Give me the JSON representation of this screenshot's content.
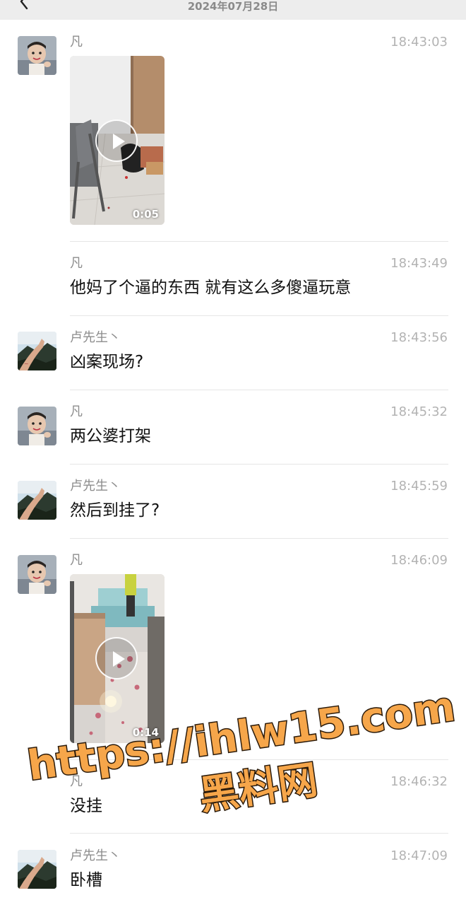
{
  "header": {
    "date": "2024年07月28日",
    "back_icon": "chevron-left-icon"
  },
  "messages": [
    {
      "sender": "凡",
      "time": "18:43:03",
      "type": "video",
      "duration": "0:05",
      "avatar": "avatar-child"
    },
    {
      "sender": "凡",
      "time": "18:43:49",
      "type": "text",
      "text": "他妈了个逼的东西 就有这么多傻逼玩意"
    },
    {
      "sender": "卢先生丶",
      "time": "18:43:56",
      "type": "text",
      "text": "凶案现场?",
      "avatar": "avatar-landscape"
    },
    {
      "sender": "凡",
      "time": "18:45:32",
      "type": "text",
      "text": "两公婆打架",
      "avatar": "avatar-child"
    },
    {
      "sender": "卢先生丶",
      "time": "18:45:59",
      "type": "text",
      "text": "然后到挂了?",
      "avatar": "avatar-landscape"
    },
    {
      "sender": "凡",
      "time": "18:46:09",
      "type": "video",
      "duration": "0:14",
      "avatar": "avatar-child"
    },
    {
      "sender": "凡",
      "time": "18:46:32",
      "type": "text",
      "text": "没挂"
    },
    {
      "sender": "卢先生丶",
      "time": "18:47:09",
      "type": "text",
      "text": "卧槽",
      "avatar": "avatar-landscape"
    }
  ],
  "watermark": {
    "line1": "https://ihlw15.com",
    "line2": "黑料网",
    "color": "#f6a64a"
  }
}
